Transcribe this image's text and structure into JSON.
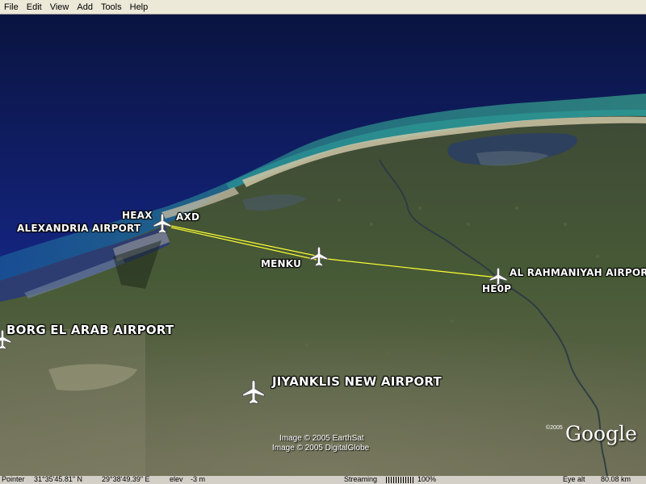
{
  "menu": [
    "File",
    "Edit",
    "View",
    "Add",
    "Tools",
    "Help"
  ],
  "labels": {
    "heax": "HEAX",
    "axd": "AXD",
    "alexandria": "ALEXANDRIA AIRPORT",
    "menku": "MENKU",
    "rahmaniyah": "AL RAHMANIYAH AIRPORT",
    "he0p": "HE0P",
    "borg": "BORG EL ARAB AIRPORT",
    "jiyanklis": "JIYANKLIS NEW AIRPORT"
  },
  "credits": {
    "earthsat": "Image © 2005 EarthSat",
    "digitalglobe": "Image © 2005 DigitalGlobe",
    "logo_year": "©2005",
    "logo": "Google"
  },
  "status": {
    "pointer_label": "Pointer",
    "pointer_lat": "31°35'45.81\" N",
    "pointer_lon": "29°38'49.39\" E",
    "elev_label": "elev",
    "elev_value": "-3 m",
    "streaming_label": "Streaming",
    "streaming_value": "100%",
    "eye_alt_label": "Eye alt",
    "eye_alt_value": "80.08 km"
  },
  "icons": {
    "airport": "airplane-icon"
  },
  "colors": {
    "route_line": "#ffff33",
    "sea_deep": "#0b1a55",
    "land": "#4a5a3a"
  }
}
